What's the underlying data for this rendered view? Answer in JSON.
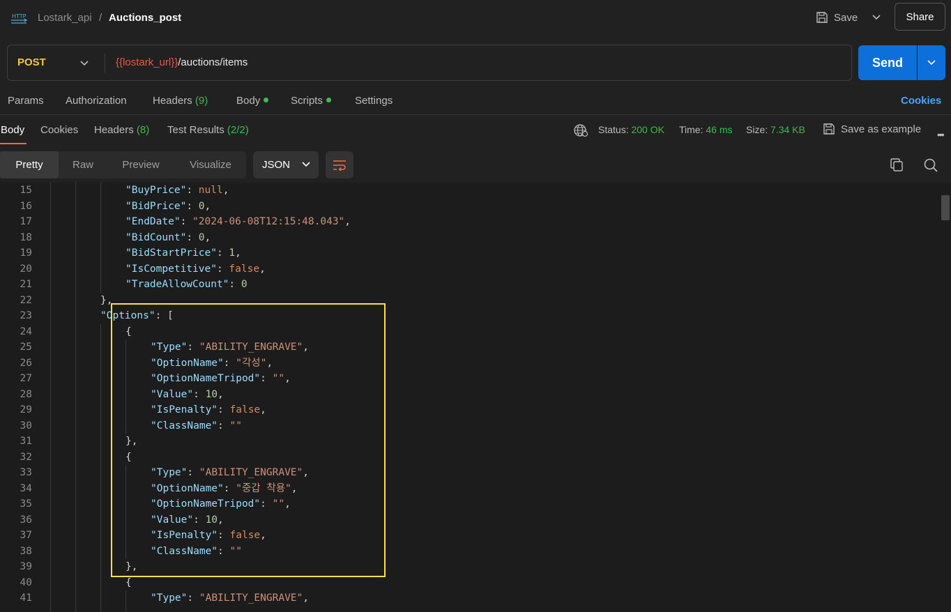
{
  "breadcrumb": {
    "parent": "Lostark_api",
    "separator": "/",
    "current": "Auctions_post"
  },
  "toolbar": {
    "save_label": "Save",
    "share_label": "Share"
  },
  "request": {
    "method": "POST",
    "url_variable": "{{lostark_url}}",
    "url_path": "/auctions/items",
    "send_label": "Send"
  },
  "request_tabs": {
    "params": "Params",
    "authorization": "Authorization",
    "headers": "Headers",
    "headers_count": "(9)",
    "body": "Body",
    "scripts": "Scripts",
    "settings": "Settings",
    "cookies": "Cookies"
  },
  "response_tabs": {
    "body": "Body",
    "cookies": "Cookies",
    "headers": "Headers",
    "headers_count": "(8)",
    "test_results": "Test Results",
    "test_results_count": "(2/2)"
  },
  "response_status": {
    "status_label": "Status:",
    "status_value": "200 OK",
    "time_label": "Time:",
    "time_value": "46 ms",
    "size_label": "Size:",
    "size_value": "7.34 KB",
    "save_example": "Save as example"
  },
  "view_modes": {
    "pretty": "Pretty",
    "raw": "Raw",
    "preview": "Preview",
    "visualize": "Visualize",
    "format": "JSON"
  },
  "colors": {
    "accent_orange": "#ff6c37",
    "send_blue": "#0d6fd9",
    "status_green": "#3fb950",
    "highlight_yellow": "#ffe23d",
    "method_yellow": "#f5c842"
  },
  "code_lines": [
    {
      "n": "15",
      "indent": 4,
      "t": [
        [
          "k",
          "\"BuyPrice\""
        ],
        [
          "p",
          ": "
        ],
        [
          "kw",
          "null"
        ],
        [
          "p",
          ","
        ]
      ]
    },
    {
      "n": "16",
      "indent": 4,
      "t": [
        [
          "k",
          "\"BidPrice\""
        ],
        [
          "p",
          ": "
        ],
        [
          "n",
          "0"
        ],
        [
          "p",
          ","
        ]
      ]
    },
    {
      "n": "17",
      "indent": 4,
      "t": [
        [
          "k",
          "\"EndDate\""
        ],
        [
          "p",
          ": "
        ],
        [
          "s",
          "\"2024-06-08T12:15:48.043\""
        ],
        [
          "p",
          ","
        ]
      ]
    },
    {
      "n": "18",
      "indent": 4,
      "t": [
        [
          "k",
          "\"BidCount\""
        ],
        [
          "p",
          ": "
        ],
        [
          "n",
          "0"
        ],
        [
          "p",
          ","
        ]
      ]
    },
    {
      "n": "19",
      "indent": 4,
      "t": [
        [
          "k",
          "\"BidStartPrice\""
        ],
        [
          "p",
          ": "
        ],
        [
          "n",
          "1"
        ],
        [
          "p",
          ","
        ]
      ]
    },
    {
      "n": "20",
      "indent": 4,
      "t": [
        [
          "k",
          "\"IsCompetitive\""
        ],
        [
          "p",
          ": "
        ],
        [
          "kw",
          "false"
        ],
        [
          "p",
          ","
        ]
      ]
    },
    {
      "n": "21",
      "indent": 4,
      "t": [
        [
          "k",
          "\"TradeAllowCount\""
        ],
        [
          "p",
          ": "
        ],
        [
          "n",
          "0"
        ]
      ]
    },
    {
      "n": "22",
      "indent": 3,
      "t": [
        [
          "p",
          "},"
        ]
      ]
    },
    {
      "n": "23",
      "indent": 3,
      "t": [
        [
          "k",
          "\"Options\""
        ],
        [
          "p",
          ": ["
        ]
      ]
    },
    {
      "n": "24",
      "indent": 4,
      "t": [
        [
          "p",
          "{"
        ]
      ]
    },
    {
      "n": "25",
      "indent": 5,
      "t": [
        [
          "k",
          "\"Type\""
        ],
        [
          "p",
          ": "
        ],
        [
          "s",
          "\"ABILITY_ENGRAVE\""
        ],
        [
          "p",
          ","
        ]
      ]
    },
    {
      "n": "26",
      "indent": 5,
      "t": [
        [
          "k",
          "\"OptionName\""
        ],
        [
          "p",
          ": "
        ],
        [
          "s",
          "\"각성\""
        ],
        [
          "p",
          ","
        ]
      ]
    },
    {
      "n": "27",
      "indent": 5,
      "t": [
        [
          "k",
          "\"OptionNameTripod\""
        ],
        [
          "p",
          ": "
        ],
        [
          "s",
          "\"\""
        ],
        [
          "p",
          ","
        ]
      ]
    },
    {
      "n": "28",
      "indent": 5,
      "t": [
        [
          "k",
          "\"Value\""
        ],
        [
          "p",
          ": "
        ],
        [
          "n",
          "10"
        ],
        [
          "p",
          ","
        ]
      ]
    },
    {
      "n": "29",
      "indent": 5,
      "t": [
        [
          "k",
          "\"IsPenalty\""
        ],
        [
          "p",
          ": "
        ],
        [
          "kw",
          "false"
        ],
        [
          "p",
          ","
        ]
      ]
    },
    {
      "n": "30",
      "indent": 5,
      "t": [
        [
          "k",
          "\"ClassName\""
        ],
        [
          "p",
          ": "
        ],
        [
          "s",
          "\"\""
        ]
      ]
    },
    {
      "n": "31",
      "indent": 4,
      "t": [
        [
          "p",
          "},"
        ]
      ]
    },
    {
      "n": "32",
      "indent": 4,
      "t": [
        [
          "p",
          "{"
        ]
      ]
    },
    {
      "n": "33",
      "indent": 5,
      "t": [
        [
          "k",
          "\"Type\""
        ],
        [
          "p",
          ": "
        ],
        [
          "s",
          "\"ABILITY_ENGRAVE\""
        ],
        [
          "p",
          ","
        ]
      ]
    },
    {
      "n": "34",
      "indent": 5,
      "t": [
        [
          "k",
          "\"OptionName\""
        ],
        [
          "p",
          ": "
        ],
        [
          "s",
          "\"중갑 착용\""
        ],
        [
          "p",
          ","
        ]
      ]
    },
    {
      "n": "35",
      "indent": 5,
      "t": [
        [
          "k",
          "\"OptionNameTripod\""
        ],
        [
          "p",
          ": "
        ],
        [
          "s",
          "\"\""
        ],
        [
          "p",
          ","
        ]
      ]
    },
    {
      "n": "36",
      "indent": 5,
      "t": [
        [
          "k",
          "\"Value\""
        ],
        [
          "p",
          ": "
        ],
        [
          "n",
          "10"
        ],
        [
          "p",
          ","
        ]
      ]
    },
    {
      "n": "37",
      "indent": 5,
      "t": [
        [
          "k",
          "\"IsPenalty\""
        ],
        [
          "p",
          ": "
        ],
        [
          "kw",
          "false"
        ],
        [
          "p",
          ","
        ]
      ]
    },
    {
      "n": "38",
      "indent": 5,
      "t": [
        [
          "k",
          "\"ClassName\""
        ],
        [
          "p",
          ": "
        ],
        [
          "s",
          "\"\""
        ]
      ]
    },
    {
      "n": "39",
      "indent": 4,
      "t": [
        [
          "p",
          "},"
        ]
      ]
    },
    {
      "n": "40",
      "indent": 4,
      "t": [
        [
          "p",
          "{"
        ]
      ]
    },
    {
      "n": "41",
      "indent": 5,
      "t": [
        [
          "k",
          "\"Type\""
        ],
        [
          "p",
          ": "
        ],
        [
          "s",
          "\"ABILITY_ENGRAVE\""
        ],
        [
          "p",
          ","
        ]
      ]
    }
  ]
}
